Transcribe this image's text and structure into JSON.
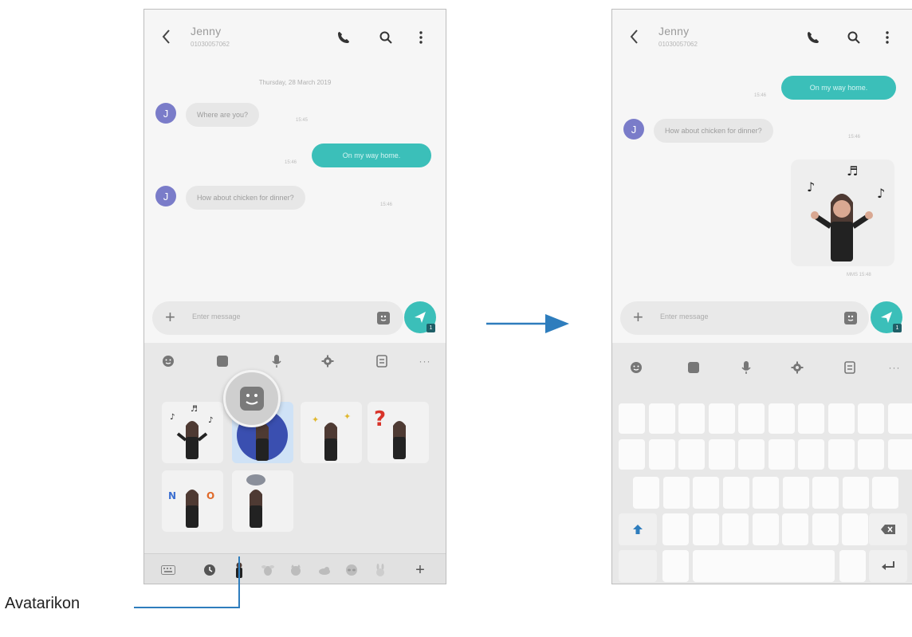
{
  "left_screen": {
    "header": {
      "contact_name": "Jenny",
      "contact_number": "01030057062"
    },
    "date_separator": "Thursday, 28 March 2019",
    "messages": [
      {
        "direction": "in",
        "text": "Where are you?",
        "time": "15:45"
      },
      {
        "direction": "out",
        "text": "On my way home.",
        "time": "15:46"
      },
      {
        "direction": "in",
        "text": "How about chicken for dinner?",
        "time": "15:46"
      }
    ],
    "input": {
      "placeholder": "Enter message"
    },
    "send_badge": "1",
    "keyboard_toolbar": [
      "emoji-icon",
      "sticker-icon",
      "mic-icon",
      "settings-icon",
      "clipboard-icon",
      "more-icon"
    ],
    "more_label": "···",
    "stickers": [
      "avatar-music-sticker",
      "avatar-night-sticker",
      "avatar-sparkle-sticker",
      "avatar-question-sticker",
      "avatar-no-sticker",
      "avatar-cloud-sticker"
    ],
    "tray_items": [
      "keyboard-icon",
      "recent-icon",
      "avatar-icon",
      "bee-icon",
      "cat-icon",
      "bird-icon",
      "sloth-icon",
      "rabbit-icon"
    ],
    "tray_add_label": "+"
  },
  "right_screen": {
    "header": {
      "contact_name": "Jenny",
      "contact_number": "01030057062"
    },
    "messages": [
      {
        "direction": "out",
        "text": "On my way home.",
        "time": "15:46"
      },
      {
        "direction": "in",
        "text": "How about chicken for dinner?",
        "time": "15:46"
      }
    ],
    "sent_sticker": {
      "time": "MMS 15:48"
    },
    "input": {
      "placeholder": "Enter message"
    },
    "send_badge": "1",
    "more_label": "···"
  },
  "callout": {
    "label": "Avatarikon"
  },
  "colors": {
    "accent": "#3bbfb9",
    "avatar": "#7a7cc9",
    "arrow": "#2e7dbd",
    "keyboard_bg": "#e8e8e8"
  }
}
